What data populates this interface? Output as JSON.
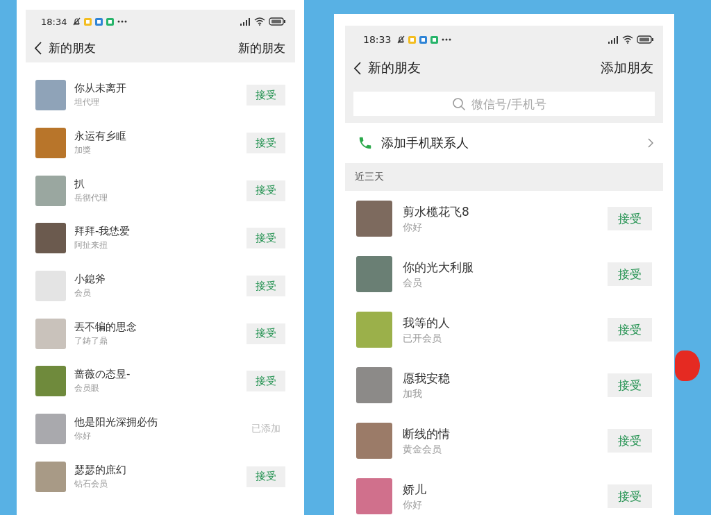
{
  "phones": [
    {
      "status_bar": {
        "time": "18:34"
      },
      "title": "新的朋友",
      "action": "新的朋友",
      "friends": [
        {
          "name": "你从未离开",
          "note": "坦代理",
          "kind": "accept",
          "label": "接受"
        },
        {
          "name": "永运有乡眶",
          "note": "加獎",
          "kind": "accept",
          "label": "接受"
        },
        {
          "name": "扒",
          "note": "岳彻代理",
          "kind": "accept",
          "label": "接受"
        },
        {
          "name": "拜拜-我恷爱",
          "note": "阿扯来扭",
          "kind": "accept",
          "label": "接受"
        },
        {
          "name": "小鎴斧",
          "note": "会员",
          "kind": "accept",
          "label": "接受"
        },
        {
          "name": "丟不犏的思念",
          "note": "了鋳了鼎",
          "kind": "accept",
          "label": "接受"
        },
        {
          "name": "蔷薇の态昱-",
          "note": "会员眼",
          "kind": "accept",
          "label": "接受"
        },
        {
          "name": "他是阳光深拥必伤",
          "note": "你好",
          "kind": "added",
          "label": "已添加"
        },
        {
          "name": "瑟瑟的庶幻",
          "note": "钻石会员",
          "kind": "accept",
          "label": "接受"
        }
      ]
    },
    {
      "status_bar": {
        "time": "18:33"
      },
      "title": "新的朋友",
      "action": "添加朋友",
      "search": {
        "placeholder": "微信号/手机号"
      },
      "add_contacts": {
        "label": "添加手机联系人"
      },
      "section": "近三天",
      "friends": [
        {
          "name": "剪水榄花飞8",
          "note": "你好",
          "kind": "accept",
          "label": "接受"
        },
        {
          "name": "你的光大利服",
          "note": "会员",
          "kind": "accept",
          "label": "接受"
        },
        {
          "name": "我等的人",
          "note": "已开会员",
          "kind": "accept",
          "label": "接受"
        },
        {
          "name": "愿我安稳",
          "note": "加我",
          "kind": "accept",
          "label": "接受"
        },
        {
          "name": "断线的情",
          "note": "黄金会员",
          "kind": "accept",
          "label": "接受"
        },
        {
          "name": "娇儿",
          "note": "你好",
          "kind": "accept",
          "label": "接受"
        }
      ]
    }
  ]
}
